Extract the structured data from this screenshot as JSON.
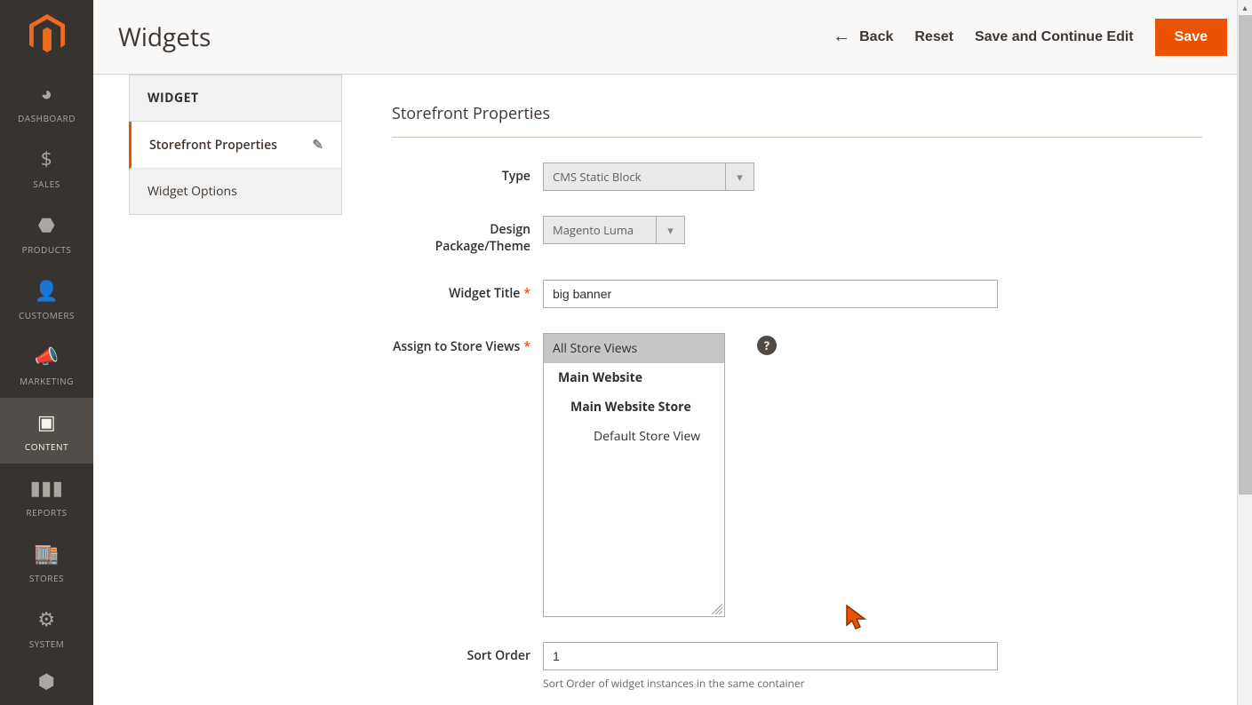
{
  "header": {
    "title": "Widgets",
    "back": "Back",
    "reset": "Reset",
    "saveContinue": "Save and Continue Edit",
    "save": "Save"
  },
  "nav": {
    "dashboard": "DASHBOARD",
    "sales": "SALES",
    "products": "PRODUCTS",
    "customers": "CUSTOMERS",
    "marketing": "MARKETING",
    "content": "CONTENT",
    "reports": "REPORTS",
    "stores": "STORES",
    "system": "SYSTEM"
  },
  "panel": {
    "head": "WIDGET",
    "storefront": "Storefront Properties",
    "options": "Widget Options"
  },
  "form": {
    "sectionTitle": "Storefront Properties",
    "typeLabel": "Type",
    "typeValue": "CMS Static Block",
    "themeLabel": "Design Package/Theme",
    "themeValue": "Magento Luma",
    "titleLabel": "Widget Title",
    "titleValue": "big banner",
    "storesLabel": "Assign to Store Views",
    "storeOptions": {
      "all": "All Store Views",
      "mainWebsite": "Main Website",
      "mainStore": "Main Website Store",
      "defaultView": "Default Store View"
    },
    "sortLabel": "Sort Order",
    "sortValue": "1",
    "sortNote": "Sort Order of widget instances in the same container"
  }
}
